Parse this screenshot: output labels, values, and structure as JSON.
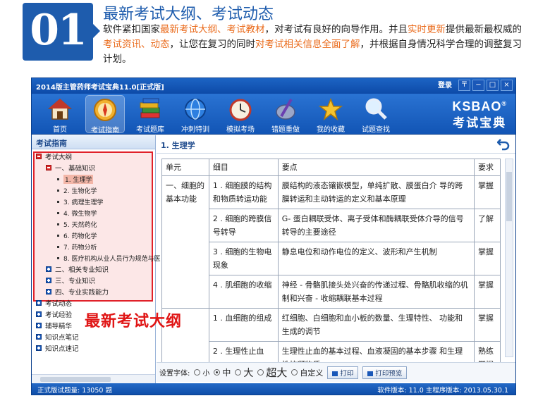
{
  "banner": {
    "number": "01",
    "headline": "最新考试大纲、考试动态",
    "desc": [
      {
        "t": "软件紧扣国家",
        "hl": false
      },
      {
        "t": "最新考试大纲、考试教材",
        "hl": true
      },
      {
        "t": "，对考试有良好的向导作用。并且",
        "hl": false
      },
      {
        "t": "实时更新",
        "hl": true
      },
      {
        "t": "提供最新最权威的",
        "hl": false
      },
      {
        "t": "考试资讯、动态",
        "hl": true
      },
      {
        "t": "，让您在复习的同时",
        "hl": false
      },
      {
        "t": "对考试相关信息全面了解",
        "hl": true
      },
      {
        "t": "，并根据自身情况科学合理的调整复习计划。",
        "hl": false
      }
    ]
  },
  "window": {
    "title": "2014版主管药师考试宝典11.0[正式版]",
    "login": "登录",
    "ctrl_menu": "〒",
    "ctrl_min": "−",
    "ctrl_max": "□",
    "ctrl_close": "×"
  },
  "toolbar": {
    "items": [
      {
        "label": "首页",
        "icon": "home-icon"
      },
      {
        "label": "考试指南",
        "icon": "compass-icon",
        "active": true
      },
      {
        "label": "考试题库",
        "icon": "books-icon"
      },
      {
        "label": "冲刺特训",
        "icon": "globe-icon"
      },
      {
        "label": "模拟考场",
        "icon": "clock-icon"
      },
      {
        "label": "错题重做",
        "icon": "pen-icon"
      },
      {
        "label": "我的收藏",
        "icon": "star-icon"
      },
      {
        "label": "试题查找",
        "icon": "magnifier-icon"
      }
    ],
    "brand_en": "KSBAO",
    "brand_reg": "®",
    "brand_cn": "考试宝典"
  },
  "left": {
    "header": "考试指南",
    "tree": [
      {
        "label": "考试大纲",
        "level": 0,
        "state": "minus"
      },
      {
        "label": "一、基础知识",
        "level": 1,
        "state": "minus"
      },
      {
        "label": "1. 生理学",
        "level": 2,
        "state": "leaf",
        "selected": true
      },
      {
        "label": "2. 生物化学",
        "level": 2,
        "state": "leaf"
      },
      {
        "label": "3. 病理生理学",
        "level": 2,
        "state": "leaf"
      },
      {
        "label": "4. 微生物学",
        "level": 2,
        "state": "leaf"
      },
      {
        "label": "5. 天然药化",
        "level": 2,
        "state": "leaf"
      },
      {
        "label": "6. 药物化学",
        "level": 2,
        "state": "leaf"
      },
      {
        "label": "7. 药物分析",
        "level": 2,
        "state": "leaf"
      },
      {
        "label": "8. 医疗机构从业人员行为规范与医",
        "level": 2,
        "state": "leaf"
      },
      {
        "label": "二、相关专业知识",
        "level": 1,
        "state": "plus"
      },
      {
        "label": "三、专业知识",
        "level": 1,
        "state": "plus"
      },
      {
        "label": "四、专业实践能力",
        "level": 1,
        "state": "plus"
      },
      {
        "label": "考试动态",
        "level": 0,
        "state": "plus"
      },
      {
        "label": "考试经验",
        "level": 0,
        "state": "plus"
      },
      {
        "label": "辅导精华",
        "level": 0,
        "state": "plus"
      },
      {
        "label": "知识点笔记",
        "level": 0,
        "state": "plus"
      },
      {
        "label": "知识点速记",
        "level": 0,
        "state": "plus"
      }
    ],
    "overlay": "最新考试大纲"
  },
  "right": {
    "header": "1. 生理学",
    "columns": [
      "单元",
      "细目",
      "要点",
      "要求"
    ],
    "unit_1": "一、细胞的基本功能",
    "unit_2": "",
    "rows": [
      {
        "item": "1 . 细胞膜的结构和物质转运功能",
        "point": "膜结构的液态镶嵌模型，单纯扩散、膜蛋白介 导的跨膜转运和主动转运的定义和基本原理",
        "req": "掌握"
      },
      {
        "item": "2 . 细胞的跨膜信号转导",
        "point": "G- 蛋白耦联受体、离子受体和酶耦联受体介导的信号转导的主要途径",
        "req": "了解"
      },
      {
        "item": "3 . 细胞的生物电现象",
        "point": "静息电位和动作电位的定义、波形和产生机制",
        "req": "掌握"
      },
      {
        "item": "4 . 肌细胞的收缩",
        "point": "神经 - 骨骼肌接头处兴奋的传递过程、骨骼肌收缩的机制和兴奋 - 收缩耦联基本过程",
        "req": "掌握"
      },
      {
        "item": "1 . 血细胞的组成",
        "point": "红细胞、白细胞和血小板的数量、生理特性、 功能和生成的调节",
        "req": "掌握"
      },
      {
        "item": "2 . 生理性止血",
        "point": "生理性止血的基本过程、血液凝固的基本步骤 和生理性抗凝物质",
        "req": "熟练掌握"
      }
    ],
    "fontbar": {
      "label": "设置字体:",
      "options": [
        {
          "label": "小",
          "size": "10px",
          "checked": false
        },
        {
          "label": "中",
          "size": "12px",
          "checked": true
        },
        {
          "label": "大",
          "size": "14px",
          "checked": false
        },
        {
          "label": "超大",
          "size": "15px",
          "checked": false
        },
        {
          "label": "自定义",
          "size": "11px",
          "checked": false
        }
      ],
      "print": "打印",
      "preview": "打印预览"
    }
  },
  "status": {
    "left": "正式版试题量: 13050 题",
    "right": "软件版本: 11.0 主程序版本: 2013.05.30.1"
  }
}
